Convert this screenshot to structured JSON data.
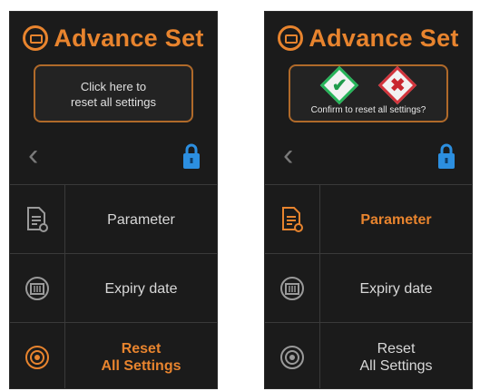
{
  "colors": {
    "accent": "#e8842e",
    "lock": "#2c8fe0",
    "confirm": "#27b45a",
    "cancel": "#d2343c",
    "background": "#1b1b1b"
  },
  "left_screen": {
    "title": "Advance Set",
    "reset_hint_line1": "Click here to",
    "reset_hint_line2": "reset all settings",
    "back_icon": "chevron-left-icon",
    "lock_icon": "lock-icon",
    "menu": [
      {
        "icon": "document-settings-icon",
        "label": "Parameter",
        "active": false
      },
      {
        "icon": "calendar-icon",
        "label": "Expiry date",
        "active": false
      },
      {
        "icon": "reset-icon",
        "label_line1": "Reset",
        "label_line2": "All Settings",
        "active": true
      }
    ]
  },
  "right_screen": {
    "title": "Advance Set",
    "confirm_text": "Confirm to reset all settings?",
    "confirm_icon": "checkmark-icon",
    "cancel_icon": "cross-icon",
    "back_icon": "chevron-left-icon",
    "lock_icon": "lock-icon",
    "menu": [
      {
        "icon": "document-settings-icon",
        "label": "Parameter",
        "active": true
      },
      {
        "icon": "calendar-icon",
        "label": "Expiry date",
        "active": false
      },
      {
        "icon": "reset-icon",
        "label_line1": "Reset",
        "label_line2": "All Settings",
        "active": false
      }
    ]
  },
  "glyphs": {
    "back": "‹",
    "check": "✔",
    "cross": "✖"
  }
}
